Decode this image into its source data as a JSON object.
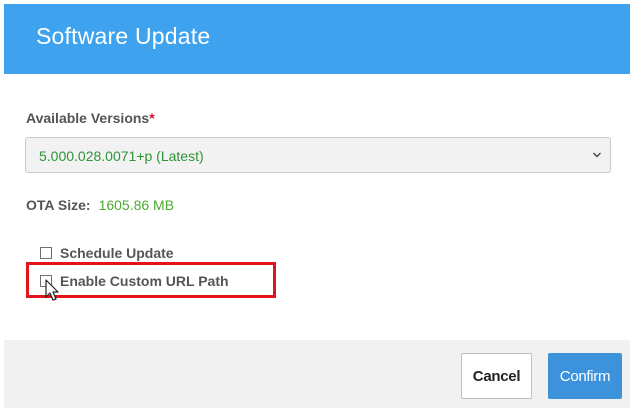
{
  "dialog": {
    "title": "Software Update"
  },
  "versions": {
    "label": "Available Versions",
    "required_mark": "*",
    "selected": "5.000.028.0071+p (Latest)"
  },
  "ota": {
    "label": "OTA Size:",
    "value": "1605.86 MB"
  },
  "options": {
    "schedule_update": {
      "label": "Schedule Update",
      "checked": false
    },
    "custom_url": {
      "label": "Enable Custom URL Path",
      "checked": false
    }
  },
  "footer": {
    "cancel_label": "Cancel",
    "confirm_label": "Confirm"
  },
  "colors": {
    "header": "#3fa2ef",
    "value_green": "#4caa2f",
    "highlight_red": "#e3131b",
    "confirm_blue": "#3c93dc"
  },
  "icons": {
    "select_arrow": "chevron-down-icon",
    "pointer": "mouse-cursor-icon"
  }
}
